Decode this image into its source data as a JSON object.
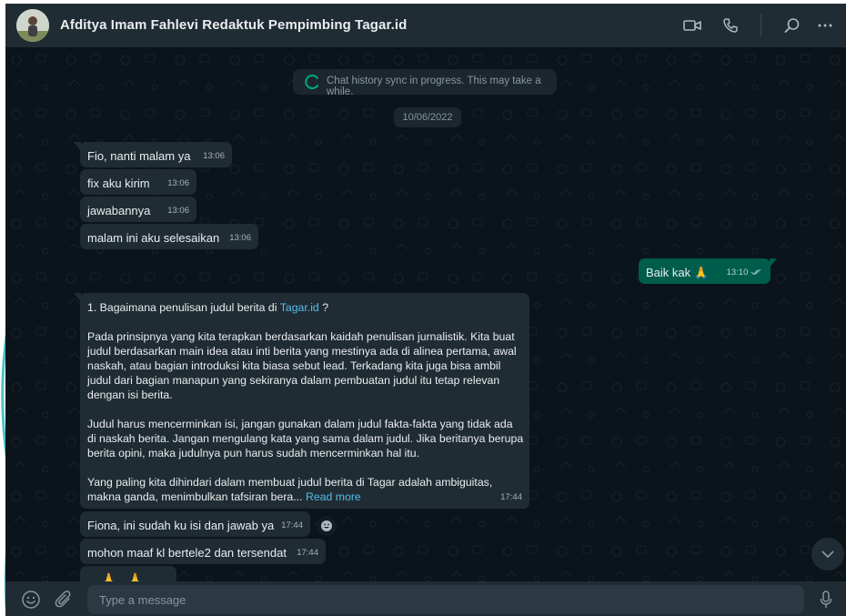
{
  "header": {
    "contact_name": "Afditya Imam Fahlevi Redaktuk Pempimbing Tagar.id",
    "icons": [
      "video-call-icon",
      "voice-call-icon",
      "search-icon",
      "menu-icon"
    ]
  },
  "chat": {
    "sync_notice": "Chat history sync in progress. This may take a while.",
    "date_divider": "10/06/2022",
    "messages": [
      {
        "direction": "in",
        "text": "Fio, nanti malam ya",
        "time": "13:06"
      },
      {
        "direction": "in",
        "text": "fix aku kirim",
        "time": "13:06"
      },
      {
        "direction": "in",
        "text": "jawabannya",
        "time": "13:06"
      },
      {
        "direction": "in",
        "text": "malam ini aku selesaikan",
        "time": "13:06"
      },
      {
        "direction": "out",
        "text": "Baik kak",
        "emoji": "🙏",
        "time": "13:10",
        "status": "read"
      },
      {
        "direction": "in",
        "time": "17:44",
        "long": {
          "line1_prefix": "1. Bagaimana penulisan judul berita di ",
          "line1_link": "Tagar.id",
          "line1_suffix": " ?",
          "para1": "Pada prinsipnya yang kita terapkan berdasarkan kaidah penulisan jurnalistik. Kita buat judul berdasarkan main idea atau inti berita yang mestinya ada di alinea pertama, awal naskah, atau bagian introduksi kita biasa sebut lead. Terkadang kita juga bisa ambil judul dari bagian manapun yang sekiranya dalam pembuatan judul itu tetap relevan dengan isi berita.",
          "para2": "Judul harus mencerminkan isi, jangan gunakan dalam judul fakta-fakta yang tidak ada di naskah berita. Jangan mengulang kata yang sama dalam judul. Jika beritanya berupa berita opini, maka judulnya pun harus sudah mencerminkan hal itu.",
          "para3": "Yang paling kita dihindari dalam membuat judul berita di Tagar adalah ambiguitas, makna ganda, menimbulkan tafsiran bera...",
          "read_more": "Read more"
        }
      },
      {
        "direction": "in",
        "text": "Fiona, ini sudah ku isi dan jawab ya",
        "time": "17:44"
      },
      {
        "direction": "in",
        "text": "mohon maaf kl bertele2 dan tersendat",
        "time": "17:44"
      },
      {
        "direction": "in",
        "text": "",
        "emoji": "🙏🙏",
        "time": ""
      }
    ]
  },
  "footer": {
    "placeholder": "Type a message"
  },
  "colors": {
    "header_bg": "#202c33",
    "chat_bg": "#0b141a",
    "incoming_bubble": "#202c33",
    "outgoing_bubble": "#005c4b",
    "link": "#53bdeb",
    "spinner": "#00a884"
  }
}
